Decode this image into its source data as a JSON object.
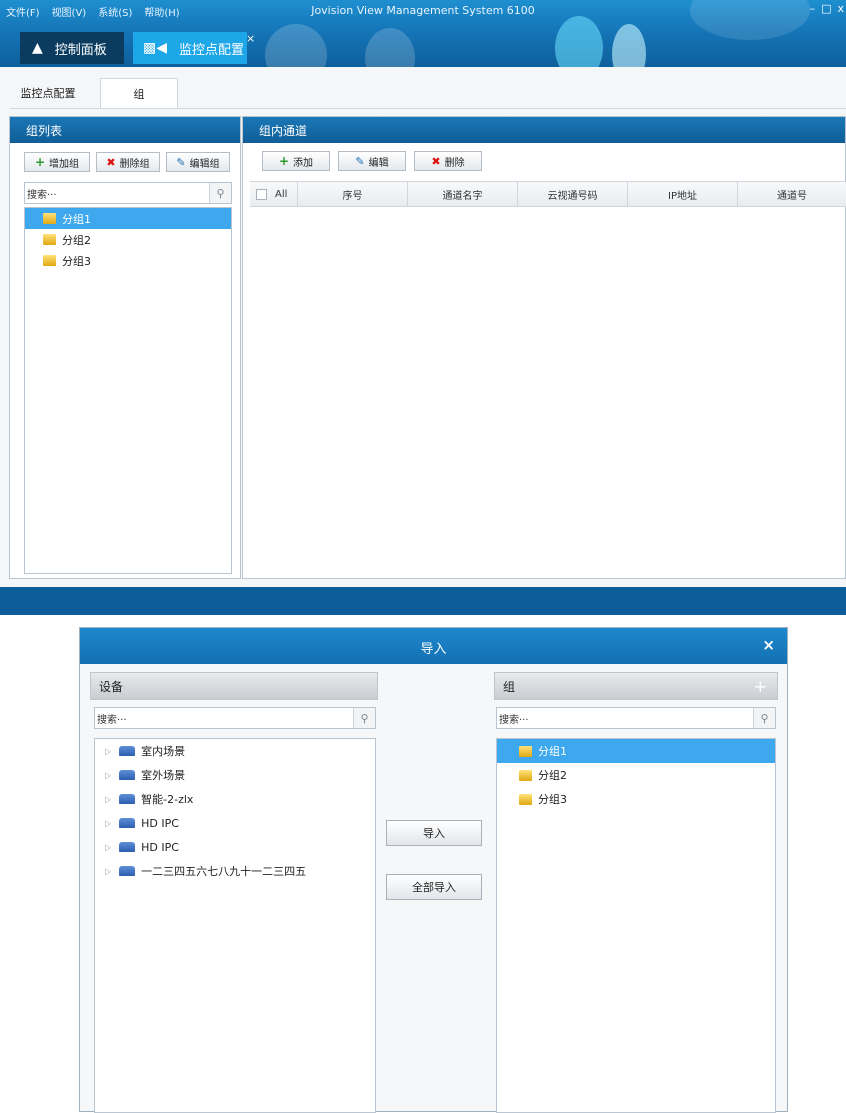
{
  "window": {
    "menu": [
      "文件(F)",
      "视图(V)",
      "系统(S)",
      "帮助(H)"
    ],
    "title": "Jovision View Management System 6100",
    "controls": [
      "–",
      "□",
      "x"
    ]
  },
  "main_tabs": {
    "home_label": "控制面板",
    "active_label": "监控点配置",
    "close": "×"
  },
  "sub_tabs": [
    "监控点配置",
    "组"
  ],
  "group_list": {
    "title": "组列表",
    "buttons": {
      "add": "增加组",
      "delete": "删除组",
      "edit": "编辑组"
    },
    "search_placeholder": "搜索···",
    "items": [
      "分组1",
      "分组2",
      "分组3"
    ],
    "selected_index": 0
  },
  "channels": {
    "title": "组内通道",
    "buttons": {
      "add": "添加",
      "edit": "编辑",
      "delete": "删除"
    },
    "columns": [
      "All",
      "序号",
      "通道名字",
      "云视通号码",
      "IP地址",
      "通道号"
    ]
  },
  "import_dialog": {
    "title": "导入",
    "close": "×",
    "devices": {
      "title": "设备",
      "search_placeholder": "搜索···",
      "items": [
        "室内场景",
        "室外场景",
        "智能-2-zlx",
        "HD IPC",
        "HD IPC",
        "一二三四五六七八九十一二三四五"
      ]
    },
    "groups": {
      "title": "组",
      "add": "+",
      "search_placeholder": "搜索···",
      "items": [
        "分组1",
        "分组2",
        "分组3"
      ],
      "selected_index": 0
    },
    "buttons": {
      "import": "导入",
      "import_all": "全部导入"
    }
  }
}
